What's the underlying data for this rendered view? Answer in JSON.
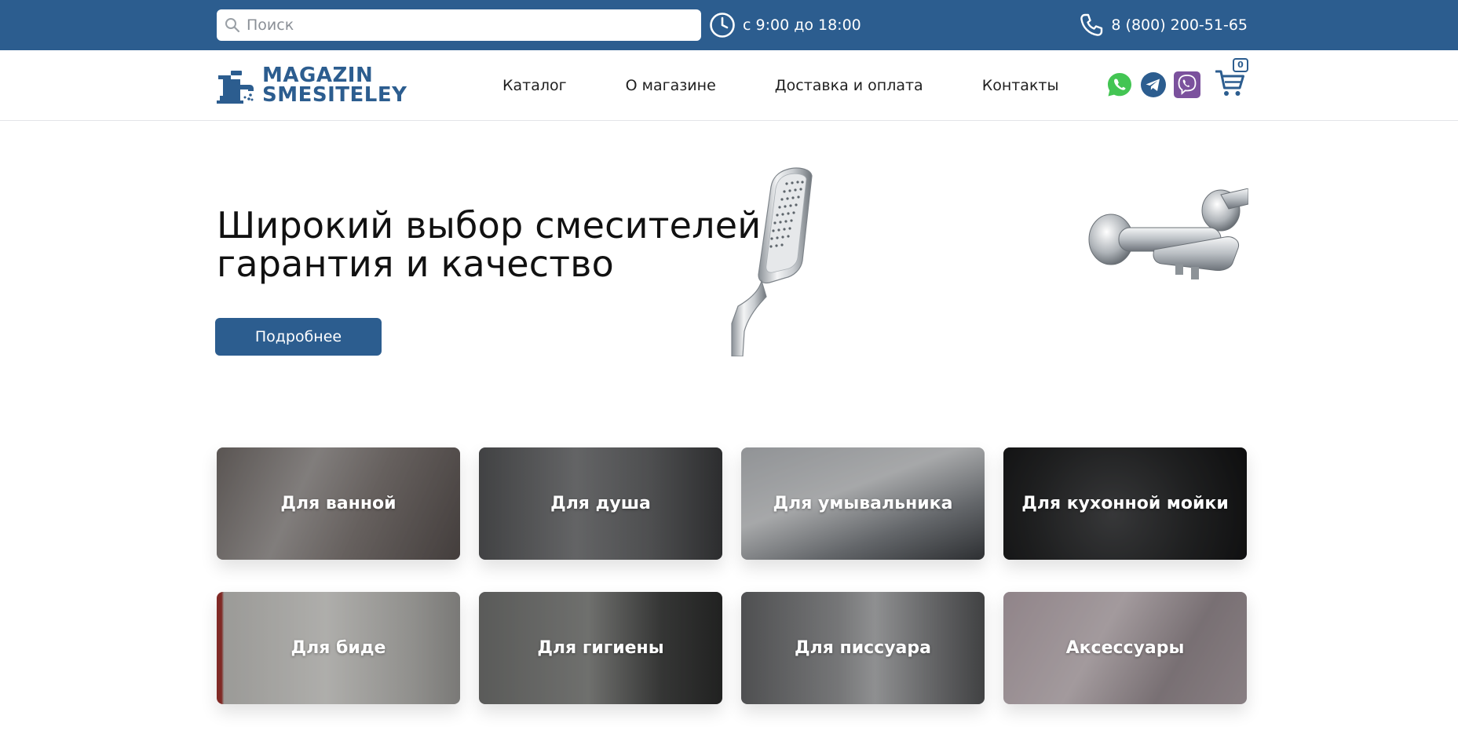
{
  "topbar": {
    "search_placeholder": "Поиск",
    "hours": "с 9:00 до 18:00",
    "phone": "8 (800) 200-51-65"
  },
  "logo": {
    "line1": "MAGAZIN",
    "line2": "SMESITELEY"
  },
  "nav": [
    {
      "label": "Каталог"
    },
    {
      "label": "О магазине"
    },
    {
      "label": "Доставка и оплата"
    },
    {
      "label": "Контакты"
    }
  ],
  "socials": [
    {
      "icon": "whatsapp-icon",
      "color": "#43c553"
    },
    {
      "icon": "telegram-icon",
      "color": "#2c5d8f"
    },
    {
      "icon": "viber-icon",
      "color": "#7b519d"
    }
  ],
  "cart": {
    "count": "0"
  },
  "hero": {
    "title_line1": "Широкий выбор смесителей",
    "title_line2": "гарантия и качество",
    "button": "Подробнее"
  },
  "categories": [
    {
      "label": "Для ванной"
    },
    {
      "label": "Для душа"
    },
    {
      "label": "Для умывальника"
    },
    {
      "label": "Для кухонной мойки"
    },
    {
      "label": "Для биде"
    },
    {
      "label": "Для гигиены"
    },
    {
      "label": "Для писсуара"
    },
    {
      "label": "Аксессуары"
    }
  ],
  "colors": {
    "brand": "#2c5d8f",
    "whatsapp": "#43c553",
    "viber": "#7b519d"
  }
}
